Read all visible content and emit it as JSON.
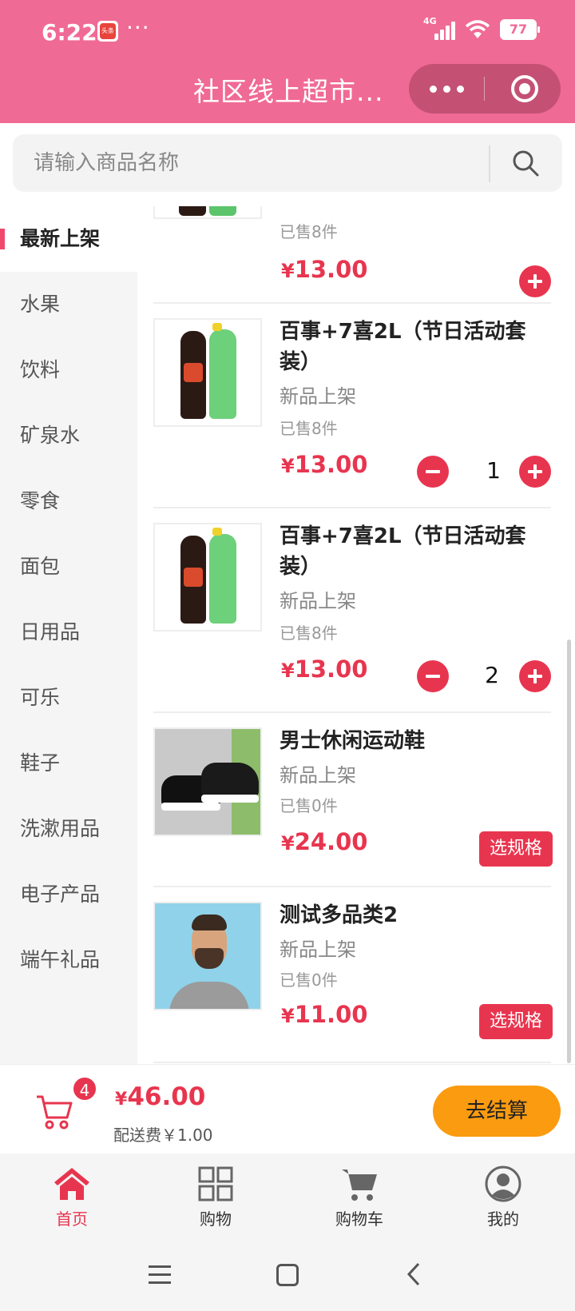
{
  "status_bar": {
    "time": "6:22",
    "app_badge": "头条",
    "dots": "···",
    "network": "4G",
    "battery": "77"
  },
  "header": {
    "title": "社区线上超市..."
  },
  "search": {
    "placeholder": "请输入商品名称"
  },
  "sidebar": {
    "items": [
      {
        "label": "最新上架",
        "active": true
      },
      {
        "label": "水果"
      },
      {
        "label": "饮料"
      },
      {
        "label": "矿泉水"
      },
      {
        "label": "零食"
      },
      {
        "label": "面包"
      },
      {
        "label": "日用品"
      },
      {
        "label": "可乐"
      },
      {
        "label": "鞋子"
      },
      {
        "label": "洗漱用品"
      },
      {
        "label": "电子产品"
      },
      {
        "label": "端午礼品"
      }
    ]
  },
  "products": [
    {
      "sold": "已售8件",
      "currency": "¥",
      "price": "13.00"
    },
    {
      "name": "百事+7喜2L（节日活动套装）",
      "tag": "新品上架",
      "sold": "已售8件",
      "currency": "¥",
      "price": "13.00",
      "qty": "1"
    },
    {
      "name": "百事+7喜2L（节日活动套装）",
      "tag": "新品上架",
      "sold": "已售8件",
      "currency": "¥",
      "price": "13.00",
      "qty": "2"
    },
    {
      "name": "男士休闲运动鞋",
      "tag": "新品上架",
      "sold": "已售0件",
      "currency": "¥",
      "price": "24.00",
      "spec_label": "选规格"
    },
    {
      "name": "测试多品类2",
      "tag": "新品上架",
      "sold": "已售0件",
      "currency": "¥",
      "price": "11.00",
      "spec_label": "选规格"
    }
  ],
  "cart": {
    "count": "4",
    "currency": "¥",
    "total": "46.00",
    "delivery_fee": "配送费￥1.00",
    "checkout_label": "去结算"
  },
  "tabbar": {
    "items": [
      {
        "label": "首页",
        "icon": "home-icon",
        "active": true
      },
      {
        "label": "购物",
        "icon": "grid-icon"
      },
      {
        "label": "购物车",
        "icon": "cart-icon"
      },
      {
        "label": "我的",
        "icon": "user-icon"
      }
    ]
  },
  "colors": {
    "header": "#f06a96",
    "accent": "#e8354f",
    "checkout": "#fb9b10"
  }
}
